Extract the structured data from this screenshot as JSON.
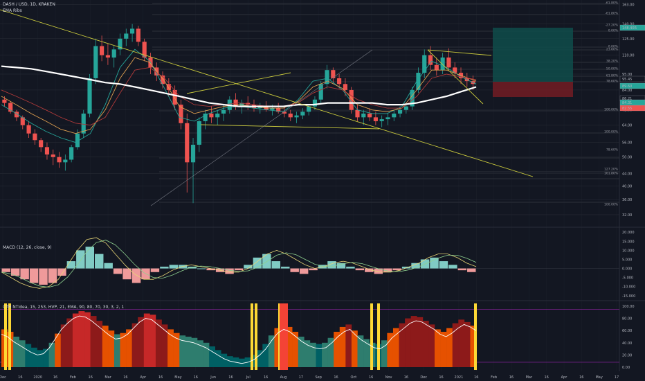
{
  "header": {
    "symbol": "DASH / USD, 1D, KRAKEN",
    "indicator": "EMA Ribs",
    "macd": "MACD (12, 26, close, 9)",
    "osc": "CTH NTIdea, 15, 253, HVP, 21, EMA, 90, 80, 70, 30, 3, 2, 1"
  },
  "colors": {
    "background": "#131722",
    "grid": "#2a2e39",
    "trendline": "#c8c83c",
    "ema200": "#ffffff",
    "up": "#26a69a",
    "down": "#ef5350",
    "long_target": "#0f4c4a",
    "long_stop": "#6e1c24",
    "macd_line": "#e8d676",
    "signal_line": "#8fd18f"
  },
  "x_labels": [
    "Dec",
    "16",
    "2020",
    "16",
    "Feb",
    "16",
    "Mar",
    "16",
    "Apr",
    "16",
    "May",
    "16",
    "Jun",
    "16",
    "Jul",
    "16",
    "Aug",
    "17",
    "Sep",
    "16",
    "Oct",
    "16",
    "Nov",
    "16",
    "Dec",
    "16",
    "2021",
    "16",
    "Feb",
    "16",
    "Mar",
    "16",
    "Apr",
    "16",
    "May",
    "17"
  ],
  "price_axis": [
    "163.00",
    "140.00",
    "125.00",
    "110.00",
    "95.00",
    "84.00",
    "72.00",
    "64.00",
    "56.00",
    "50.00",
    "44.00",
    "40.00",
    "36.00",
    "32.00"
  ],
  "price_axis_badges": [
    {
      "label": "148.40R",
      "color": "#26a69a"
    },
    {
      "label": "95.45",
      "color": "#131722"
    },
    {
      "label": "89.60",
      "color": "#26a69a"
    },
    {
      "label": "86.21",
      "color": "#131722"
    },
    {
      "label": "84.31",
      "color": "#26a69a"
    },
    {
      "label": "82.55",
      "color": "#ef5350"
    }
  ],
  "fib_labels": [
    "-61.80%",
    "-61.80%",
    "-27.20%",
    "0.00%",
    "0.00%",
    "23.60%",
    "38.20%",
    "50.00%",
    "61.80%",
    "78.60%",
    "100.00%",
    "100.00%",
    "78.60%",
    "127.20%",
    "161.80%",
    "100.00%"
  ],
  "macd_axis": [
    "20.000",
    "15.000",
    "10.000",
    "5.000",
    "0.000",
    "-5.000",
    "-10.000",
    "-15.000"
  ],
  "osc_axis": [
    "100.00",
    "80.00",
    "60.00",
    "40.00",
    "20.00",
    "0.00"
  ],
  "chart_data": {
    "type": "candlestick",
    "title": "DASH / USD, 1D, KRAKEN",
    "x_range": [
      "Dec 2019",
      "May 2021"
    ],
    "y_scale": "log",
    "ylim": [
      30,
      165
    ],
    "grid": true,
    "candles": [
      [
        78,
        80,
        74,
        76
      ],
      [
        76,
        77,
        70,
        71
      ],
      [
        71,
        72,
        66,
        68
      ],
      [
        68,
        69,
        62,
        64
      ],
      [
        64,
        66,
        58,
        60
      ],
      [
        60,
        62,
        55,
        57
      ],
      [
        57,
        58,
        52,
        54
      ],
      [
        54,
        56,
        49,
        51
      ],
      [
        51,
        53,
        47,
        50
      ],
      [
        50,
        52,
        46,
        48
      ],
      [
        48,
        51,
        45,
        49
      ],
      [
        49,
        55,
        48,
        54
      ],
      [
        54,
        62,
        53,
        60
      ],
      [
        60,
        72,
        58,
        70
      ],
      [
        70,
        95,
        68,
        92
      ],
      [
        92,
        125,
        88,
        118
      ],
      [
        118,
        128,
        105,
        110
      ],
      [
        110,
        120,
        102,
        108
      ],
      [
        108,
        118,
        100,
        115
      ],
      [
        115,
        130,
        110,
        125
      ],
      [
        125,
        135,
        118,
        130
      ],
      [
        130,
        140,
        122,
        135
      ],
      [
        135,
        138,
        118,
        122
      ],
      [
        122,
        125,
        105,
        108
      ],
      [
        108,
        112,
        95,
        100
      ],
      [
        100,
        104,
        90,
        94
      ],
      [
        94,
        97,
        85,
        88
      ],
      [
        88,
        92,
        80,
        84
      ],
      [
        84,
        87,
        72,
        75
      ],
      [
        75,
        78,
        62,
        65
      ],
      [
        65,
        70,
        38,
        48
      ],
      [
        48,
        58,
        35,
        55
      ],
      [
        55,
        68,
        52,
        66
      ],
      [
        66,
        72,
        62,
        70
      ],
      [
        70,
        74,
        65,
        68
      ],
      [
        68,
        72,
        64,
        70
      ],
      [
        70,
        75,
        66,
        72
      ],
      [
        72,
        80,
        70,
        78
      ],
      [
        78,
        82,
        72,
        74
      ],
      [
        74,
        78,
        70,
        76
      ],
      [
        76,
        80,
        72,
        75
      ],
      [
        75,
        78,
        71,
        73
      ],
      [
        73,
        76,
        70,
        74
      ],
      [
        74,
        77,
        71,
        72
      ],
      [
        72,
        75,
        69,
        73
      ],
      [
        73,
        76,
        70,
        71
      ],
      [
        71,
        74,
        68,
        70
      ],
      [
        70,
        72,
        66,
        68
      ],
      [
        68,
        71,
        65,
        69
      ],
      [
        69,
        73,
        67,
        71
      ],
      [
        71,
        75,
        69,
        74
      ],
      [
        74,
        80,
        72,
        78
      ],
      [
        78,
        90,
        76,
        88
      ],
      [
        88,
        102,
        85,
        98
      ],
      [
        98,
        100,
        88,
        92
      ],
      [
        92,
        95,
        85,
        88
      ],
      [
        88,
        92,
        80,
        84
      ],
      [
        84,
        86,
        70,
        72
      ],
      [
        72,
        75,
        66,
        68
      ],
      [
        68,
        72,
        64,
        70
      ],
      [
        70,
        73,
        66,
        68
      ],
      [
        68,
        71,
        64,
        66
      ],
      [
        66,
        69,
        63,
        67
      ],
      [
        67,
        70,
        64,
        68
      ],
      [
        68,
        72,
        66,
        70
      ],
      [
        70,
        74,
        68,
        72
      ],
      [
        72,
        76,
        70,
        74
      ],
      [
        74,
        86,
        72,
        84
      ],
      [
        84,
        100,
        82,
        96
      ],
      [
        96,
        115,
        92,
        110
      ],
      [
        110,
        118,
        98,
        102
      ],
      [
        102,
        108,
        94,
        98
      ],
      [
        98,
        112,
        95,
        108
      ],
      [
        108,
        116,
        98,
        100
      ],
      [
        100,
        104,
        92,
        96
      ],
      [
        96,
        100,
        88,
        92
      ],
      [
        92,
        96,
        86,
        90
      ],
      [
        90,
        94,
        84,
        88
      ]
    ],
    "ema_ribbon": [
      {
        "name": "EMA fast",
        "color": "#26a69a",
        "values": [
          75,
          70,
          65,
          61,
          58,
          56,
          60,
          75,
          100,
          115,
          105,
          85,
          68,
          66,
          70,
          73,
          74,
          73,
          72,
          71,
          78,
          90,
          92,
          84,
          72,
          70,
          70,
          74,
          90,
          105,
          100,
          93,
          88
        ]
      },
      {
        "name": "EMA mid",
        "color": "#e0a050",
        "values": [
          80,
          75,
          70,
          66,
          62,
          60,
          62,
          72,
          92,
          108,
          104,
          90,
          74,
          70,
          72,
          74,
          75,
          74,
          73,
          73,
          77,
          86,
          90,
          85,
          75,
          72,
          71,
          73,
          84,
          98,
          98,
          94,
          90
        ]
      },
      {
        "name": "EMA slow",
        "color": "#b03a3a",
        "values": [
          84,
          80,
          76,
          72,
          68,
          65,
          64,
          68,
          82,
          98,
          100,
          92,
          80,
          75,
          74,
          75,
          76,
          75,
          74,
          74,
          76,
          82,
          86,
          84,
          78,
          75,
          73,
          73,
          80,
          92,
          95,
          93,
          91
        ]
      }
    ],
    "ema200": [
      101,
      100,
      99,
      97,
      95,
      93,
      91,
      89,
      88,
      86,
      84,
      82,
      80,
      78,
      76,
      75,
      74,
      74,
      74,
      74,
      75,
      75,
      76,
      76,
      76,
      76,
      75,
      75,
      76,
      78,
      80,
      83,
      86
    ],
    "macd_hist": [
      -2,
      -4,
      -6,
      -8,
      -9,
      -8,
      -4,
      4,
      10,
      12,
      8,
      3,
      -3,
      -6,
      -8,
      -6,
      -2,
      1,
      2,
      2,
      1,
      0,
      -1,
      -2,
      -3,
      -1,
      2,
      6,
      8,
      4,
      1,
      -2,
      -3,
      -1,
      2,
      4,
      3,
      1,
      -1,
      -2,
      -3,
      -2,
      -1,
      1,
      3,
      5,
      6,
      4,
      2,
      -1,
      -2
    ],
    "macd_line": [
      -2,
      -5,
      -8,
      -10,
      -11,
      -10,
      -6,
      2,
      10,
      16,
      17,
      14,
      8,
      2,
      -3,
      -6,
      -6,
      -4,
      -1,
      1,
      2,
      1,
      0,
      -1,
      -2,
      -2,
      0,
      4,
      8,
      10,
      8,
      5,
      2,
      0,
      1,
      3,
      4,
      3,
      1,
      -1,
      -2,
      -2,
      -1,
      1,
      3,
      6,
      8,
      8,
      6,
      3,
      1
    ],
    "osc_values": [
      62,
      58,
      50,
      44,
      38,
      32,
      28,
      30,
      40,
      55,
      70,
      80,
      88,
      92,
      90,
      84,
      76,
      68,
      60,
      54,
      56,
      62,
      72,
      82,
      88,
      86,
      78,
      70,
      62,
      56,
      52,
      50,
      48,
      44,
      40,
      34,
      28,
      22,
      18,
      16,
      14,
      16,
      20,
      28,
      38,
      52,
      64,
      70,
      66,
      58,
      50,
      44,
      40,
      38,
      40,
      48,
      58,
      66,
      70,
      60,
      52,
      46,
      40,
      38,
      44,
      56,
      64,
      72,
      80,
      84,
      82,
      76,
      70,
      62,
      58,
      64,
      72,
      78,
      74,
      68
    ]
  }
}
